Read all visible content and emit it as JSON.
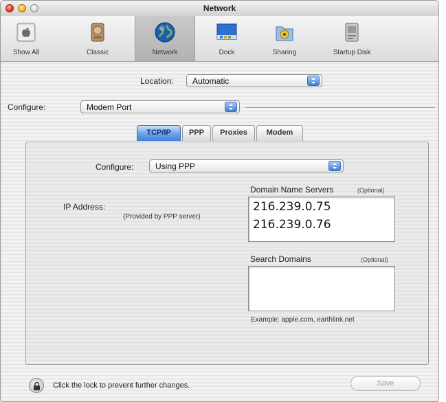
{
  "window": {
    "title": "Network"
  },
  "toolbar": {
    "items": [
      {
        "label": "Show All",
        "icon": "apple-icon"
      },
      {
        "label": "Classic",
        "icon": "classic-icon"
      },
      {
        "label": "Network",
        "icon": "globe-icon",
        "selected": true
      },
      {
        "label": "Dock",
        "icon": "dock-icon"
      },
      {
        "label": "Sharing",
        "icon": "sharing-folder-icon"
      },
      {
        "label": "Startup Disk",
        "icon": "disk-icon"
      }
    ]
  },
  "location": {
    "label": "Location:",
    "value": "Automatic"
  },
  "configure_port": {
    "label": "Configure:",
    "value": "Modem Port"
  },
  "tabs": [
    {
      "label": "TCP/IP",
      "active": true
    },
    {
      "label": "PPP"
    },
    {
      "label": "Proxies"
    },
    {
      "label": "Modem"
    }
  ],
  "tcpip": {
    "configure_label": "Configure:",
    "configure_value": "Using PPP",
    "ip_label": "IP Address:",
    "ip_note": "(Provided by PPP server)",
    "dns_label": "Domain Name Servers",
    "dns_optional": "(Optional)",
    "dns_servers": [
      "216.239.0.75",
      "216.239.0.76"
    ],
    "search_label": "Search Domains",
    "search_optional": "(Optional)",
    "search_value": "",
    "example": "Example: apple.com, earthlink.net"
  },
  "footer": {
    "lock_text": "Click the lock to prevent further changes.",
    "save_label": "Save"
  },
  "colors": {
    "accent": "#3f82df",
    "window_bg": "#ececec"
  }
}
